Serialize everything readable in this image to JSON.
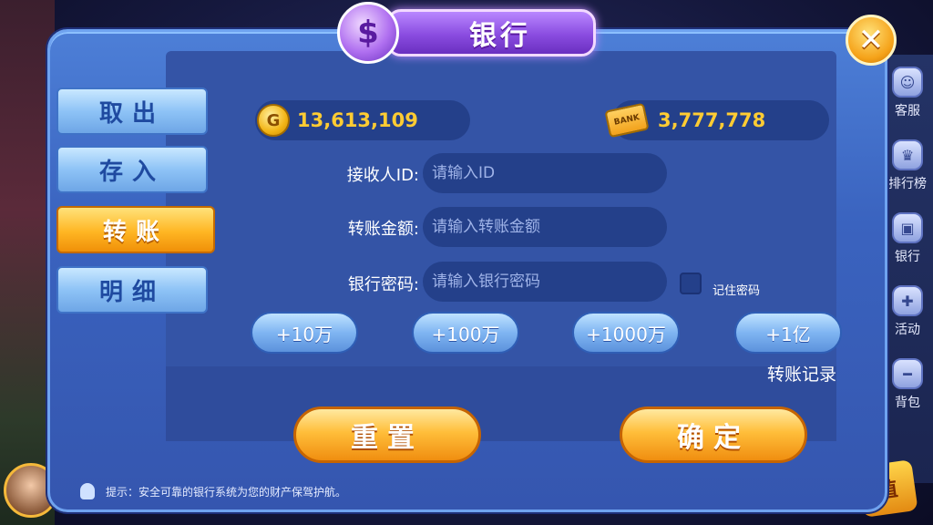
{
  "side_menu": [
    {
      "label": "客服",
      "icon": "headset-icon",
      "glyph": "☺"
    },
    {
      "label": "排行榜",
      "icon": "trophy-icon",
      "glyph": "♛"
    },
    {
      "label": "银行",
      "icon": "bank-icon",
      "glyph": "▣"
    },
    {
      "label": "活动",
      "icon": "gift-icon",
      "glyph": "✚"
    },
    {
      "label": "背包",
      "icon": "bag-icon",
      "glyph": "━"
    }
  ],
  "recharge": {
    "label": "值"
  },
  "dialog": {
    "title": "银行",
    "close_label": "✕"
  },
  "tabs": {
    "withdraw": "取出",
    "deposit": "存入",
    "transfer": "转账",
    "details": "明细"
  },
  "balances": {
    "coins": "13,613,109",
    "bank": "3,777,778",
    "bank_icon_text": "BANK"
  },
  "form": {
    "recipient_label": "接收人ID:",
    "recipient_placeholder": "请输入ID",
    "amount_label": "转账金额:",
    "amount_placeholder": "请输入转账金额",
    "password_label": "银行密码:",
    "password_placeholder": "请输入银行密码",
    "remember_label": "记住密码"
  },
  "chips": [
    "+10万",
    "+100万",
    "+1000万",
    "+1亿"
  ],
  "record_link": "转账记录",
  "actions": {
    "reset": "重置",
    "confirm": "确定"
  },
  "tip": "提示：安全可靠的银行系统为您的财产保驾护航。",
  "colors": {
    "accent_gold": "#ffb623",
    "panel_blue": "#3454a6",
    "title_purple": "#8a4ce0"
  }
}
